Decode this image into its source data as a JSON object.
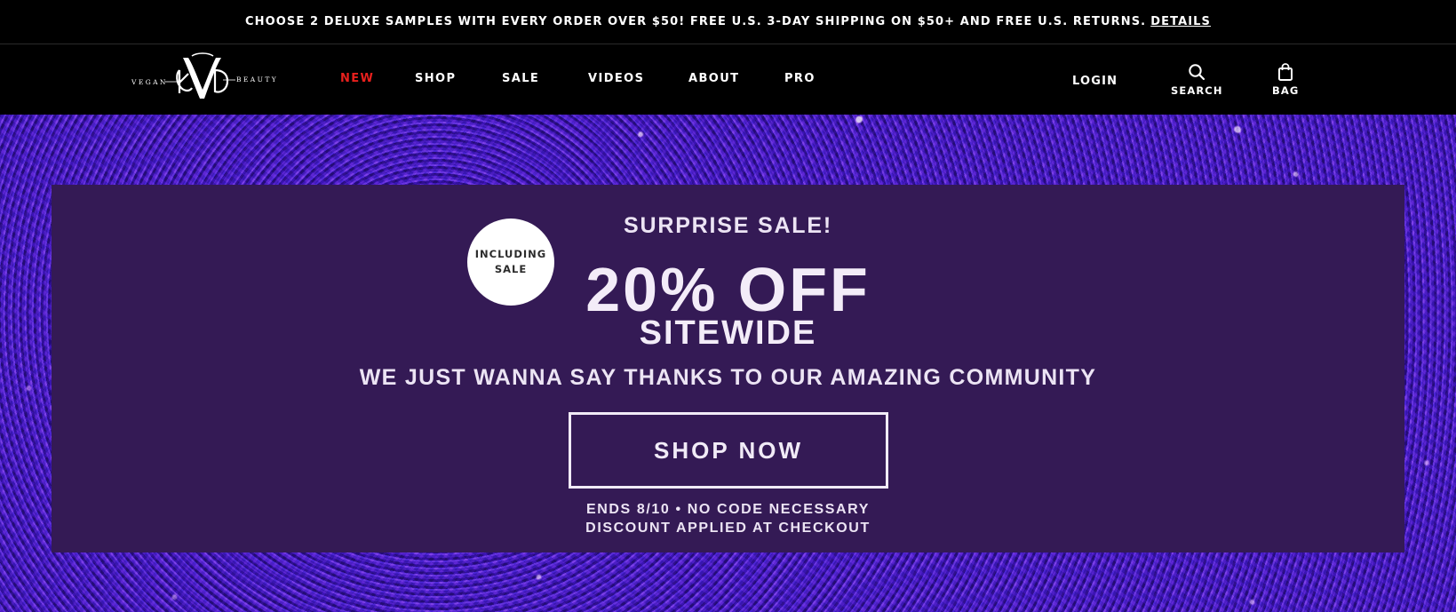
{
  "promo_bar": {
    "text": "CHOOSE 2 DELUXE SAMPLES WITH EVERY ORDER OVER $50! FREE U.S. 3-DAY SHIPPING ON $50+ AND FREE U.S. RETURNS.",
    "link_label": "DETAILS"
  },
  "header": {
    "logo": {
      "left_text": "VEGAN",
      "right_text": "BEAUTY",
      "monogram": "KVD"
    },
    "nav": [
      {
        "label": "NEW",
        "highlight": true
      },
      {
        "label": "SHOP"
      },
      {
        "label": "SALE"
      },
      {
        "label": "VIDEOS"
      },
      {
        "label": "ABOUT"
      },
      {
        "label": "PRO"
      }
    ],
    "utilities": {
      "login_label": "LOGIN",
      "search_label": "SEARCH",
      "search_icon": "search-icon",
      "bag_label": "BAG",
      "bag_icon": "bag-icon"
    }
  },
  "hero": {
    "badge_line1": "INCLUDING",
    "badge_line2": "SALE",
    "eyebrow": "SURPRISE SALE!",
    "headline": "20% OFF",
    "subheadline": "SITEWIDE",
    "tagline": "WE JUST WANNA SAY THANKS TO OUR AMAZING COMMUNITY",
    "cta_label": "SHOP NOW",
    "fine_print_line1": "ENDS 8/10 • NO CODE NECESSARY",
    "fine_print_line2": "DISCOUNT APPLIED AT CHECKOUT"
  },
  "colors": {
    "nav_highlight": "#e8201d",
    "panel_bg": "#341a55",
    "glitter_base": "#4a22a0",
    "text_light": "#f3ecf8"
  }
}
